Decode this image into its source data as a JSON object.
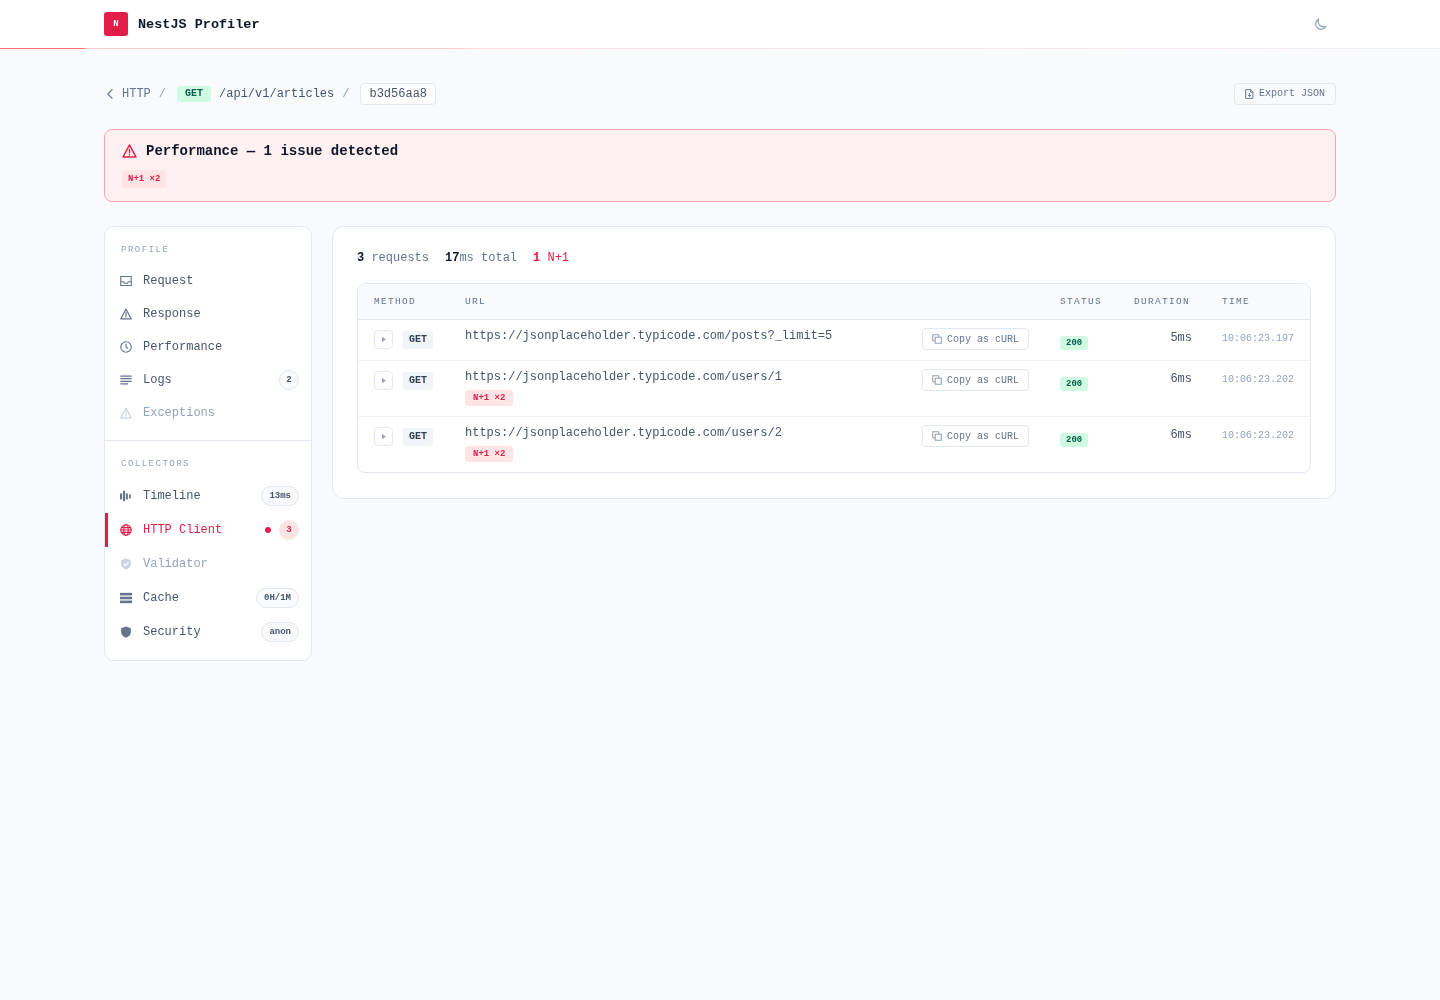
{
  "header": {
    "logo": "N",
    "title": "NestJS Profiler"
  },
  "breadcrumb": [
    {
      "kind": "back",
      "text": "HTTP"
    },
    {
      "kind": "separator",
      "text": "/"
    },
    {
      "kind": "method",
      "text": "GET"
    },
    {
      "kind": "path",
      "text": "/api/v1/articles"
    },
    {
      "kind": "separator",
      "text": "/"
    },
    {
      "kind": "id",
      "text": "b3d56aa8"
    }
  ],
  "export_button": "Export JSON",
  "alert": {
    "title": "Performance — 1 issue detected",
    "badges": [
      "N+1 ×2"
    ]
  },
  "sidebar": {
    "sections": [
      {
        "title": "PROFILE",
        "items": [
          {
            "label": "Request",
            "selected": false,
            "disabled": false,
            "alert": false
          },
          {
            "label": "Response",
            "selected": false,
            "disabled": false,
            "alert": false
          },
          {
            "label": "Performance",
            "selected": false,
            "disabled": false,
            "alert": false
          },
          {
            "label": "Logs",
            "badge": "2",
            "selected": false,
            "disabled": false,
            "alert": false
          },
          {
            "label": "Exceptions",
            "selected": false,
            "disabled": true,
            "alert": false
          }
        ]
      },
      {
        "title": "COLLECTORS",
        "items": [
          {
            "label": "Timeline",
            "badge": "13ms",
            "selected": false,
            "disabled": false,
            "alert": false
          },
          {
            "label": "HTTP Client",
            "badge": "3",
            "selected": true,
            "disabled": false,
            "alert": true
          },
          {
            "label": "Validator",
            "selected": false,
            "disabled": true,
            "alert": false
          },
          {
            "label": "Cache",
            "badge": "0H/1M",
            "selected": false,
            "disabled": false,
            "alert": false
          },
          {
            "label": "Security",
            "badge": "anon",
            "selected": false,
            "disabled": false,
            "alert": false
          }
        ]
      }
    ]
  },
  "summary": [
    {
      "kind": "count",
      "text": "**3** requests"
    },
    {
      "kind": "count",
      "text": "**17**ms total"
    },
    {
      "kind": "issue",
      "text": "**1** N+1"
    }
  ],
  "table": {
    "columns": [
      "METHOD",
      "URL",
      "STATUS",
      "DURATION",
      "TIME"
    ],
    "rows": [
      {
        "expanded": false,
        "method": "GET",
        "url": "https://jsonplaceholder.typicode.com/posts?_limit=5",
        "copy_button": "Copy as cURL",
        "status": "200",
        "duration": "5ms",
        "time": "10:06:23.197"
      },
      {
        "expanded": false,
        "method": "GET",
        "url": "https://jsonplaceholder.typicode.com/users/1",
        "issues": [
          "N+1 ×2"
        ],
        "copy_button": "Copy as cURL",
        "status": "200",
        "duration": "6ms",
        "time": "10:06:23.202"
      },
      {
        "expanded": false,
        "method": "GET",
        "url": "https://jsonplaceholder.typicode.com/users/2",
        "issues": [
          "N+1 ×2"
        ],
        "copy_button": "Copy as cURL",
        "status": "200",
        "duration": "6ms",
        "time": "10:06:23.202"
      }
    ]
  }
}
